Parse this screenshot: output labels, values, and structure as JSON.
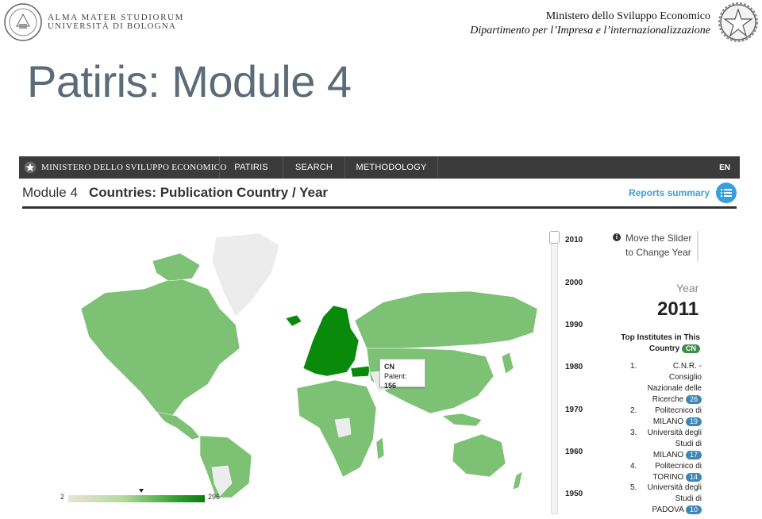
{
  "slide": {
    "university_line1": "ALMA MATER STUDIORUM",
    "university_line2": "UNIVERSITÀ DI BOLOGNA",
    "ministry_line1": "Ministero dello Sviluppo Economico",
    "ministry_line2": "Dipartimento per l’Impresa e l’internazionalizzazione",
    "title": "Patiris: Module 4"
  },
  "navbar": {
    "brand": "MINISTERO DELLO SVILUPPO ECONOMICO",
    "items": [
      "PATIRIS",
      "SEARCH",
      "METHODOLOGY"
    ],
    "lang": "EN"
  },
  "module": {
    "number": "Module 4",
    "title": "Countries: Publication Country / Year",
    "reports_link": "Reports summary"
  },
  "map": {
    "tooltip_country": "CN",
    "tooltip_label": "Patent:",
    "tooltip_value": "156",
    "legend_min": "2",
    "legend_max": "296",
    "colors": {
      "low": "#e8e4d4",
      "mid": "#7cc174",
      "high": "#0a8a0a",
      "none": "#ececec"
    }
  },
  "slider": {
    "years": [
      "2010",
      "2000",
      "1990",
      "1980",
      "1970",
      "1960",
      "1950"
    ]
  },
  "info": {
    "text_line1": "Move the Slider",
    "text_line2": "to Change Year"
  },
  "panel": {
    "year_label": "Year",
    "year_value": "2011",
    "top_title_line1": "Top Institutes in This",
    "top_title_line2": "Country",
    "country_badge": "CN",
    "institutes": [
      {
        "num": "1.",
        "name": "C.N.R. - Consiglio Nazionale delle Ricerche",
        "count": "26"
      },
      {
        "num": "2.",
        "name": "Politecnico di MILANO",
        "count": "19"
      },
      {
        "num": "3.",
        "name": "Università degli Studi di MILANO",
        "count": "17"
      },
      {
        "num": "4.",
        "name": "Politecnico di TORINO",
        "count": "14"
      },
      {
        "num": "5.",
        "name": "Università degli Studi di PADOVA",
        "count": "10"
      }
    ]
  }
}
